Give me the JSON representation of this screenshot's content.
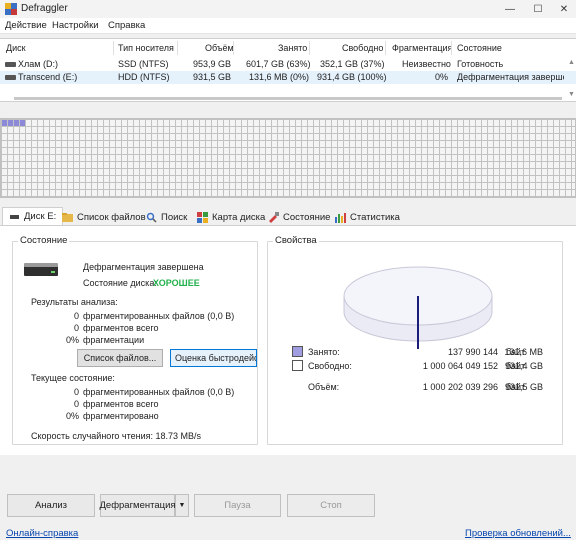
{
  "window": {
    "title": "Defraggler"
  },
  "menu": [
    "Действие",
    "Настройки",
    "Справка"
  ],
  "drive_list": {
    "columns": [
      "Диск",
      "Тип носителя",
      "Объём",
      "Занято",
      "Свободно",
      "Фрагментация",
      "Состояние"
    ],
    "rows": [
      {
        "disk": "Хлам (D:)",
        "media": "SSD (NTFS)",
        "size": "953,9 GB",
        "used": "601,7 GB (63%)",
        "free": "352,1 GB (37%)",
        "frag": "Неизвестно",
        "status": "Готовность",
        "selected": false
      },
      {
        "disk": "Transcend (E:)",
        "media": "HDD (NTFS)",
        "size": "931,5 GB",
        "used": "131,6 MB (0%)",
        "free": "931,4 GB (100%)",
        "frag": "0%",
        "status": "Дефрагментация завершена",
        "selected": true
      }
    ]
  },
  "tabs": [
    "Диск E:",
    "Список файлов",
    "Поиск",
    "Карта диска",
    "Состояние",
    "Статистика"
  ],
  "status_panel": {
    "title": "Состояние",
    "defrag_status": "Дефрагментация завершена",
    "health_label": "Состояние диска:",
    "health_value": "ХОРОШЕЕ",
    "health_color": "#22b14c",
    "analysis_title": "Результаты анализа:",
    "analysis": [
      {
        "value": "0",
        "label": "фрагментированных файлов (0,0 B)"
      },
      {
        "value": "0",
        "label": "фрагментов всего"
      },
      {
        "value": "0%",
        "label": "фрагментации"
      }
    ],
    "file_list_button": "Список файлов...",
    "quick_defrag_button": "Оценка быстродействия",
    "current_title": "Текущее состояние:",
    "current": [
      {
        "value": "0",
        "label": "фрагментированных файлов (0,0 B)"
      },
      {
        "value": "0",
        "label": "фрагментов всего"
      },
      {
        "value": "0%",
        "label": "фрагментировано"
      }
    ],
    "read_speed": "Скорость случайного чтения: 18.73 MB/s"
  },
  "properties_panel": {
    "title": "Свойства",
    "used_fraction": 0.0001,
    "used_color": "#a09ee0",
    "free_color": "#ffffff",
    "rows": [
      {
        "label": "Занято:",
        "bytes": "137 990 144",
        "unit": "байт",
        "human": "131,6 MB"
      },
      {
        "label": "Свободно:",
        "bytes": "1 000 064 049 152",
        "unit": "байт",
        "human": "931,4 GB"
      },
      {
        "label": "Объём:",
        "bytes": "1 000 202 039 296",
        "unit": "байт",
        "human": "931,5 GB"
      }
    ]
  },
  "buttons": {
    "analyze": "Анализ",
    "defrag": "Дефрагментация",
    "pause": "Пауза",
    "stop": "Стоп"
  },
  "links": {
    "help": "Онлайн-справка",
    "updates": "Проверка обновлений..."
  },
  "blockmap": {
    "used_color": "#8c8ad8"
  }
}
